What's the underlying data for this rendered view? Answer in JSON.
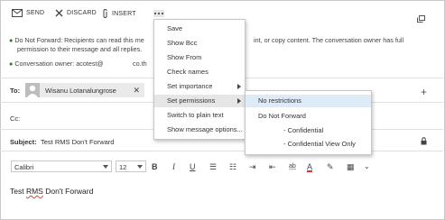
{
  "toolbar": {
    "send_label": "SEND",
    "discard_label": "DISCARD",
    "insert_label": "INSERT"
  },
  "info": {
    "dnf_text_1": "Do Not Forward: Recipients can read this me",
    "dnf_text_2": "int, or copy content. The conversation owner has full",
    "dnf_text_3": "permission to their message and all replies.",
    "owner_label": "Conversation owner: acotest@",
    "owner_domain": "co.th"
  },
  "to": {
    "label": "To:",
    "recipient": "Wisanu Lotanalungrose"
  },
  "cc": {
    "label": "Cc:"
  },
  "subject": {
    "label": "Subject:",
    "value": "Test RMS Don't Forward"
  },
  "format": {
    "font": "Calibri",
    "size": "12"
  },
  "body": {
    "text_prefix": "Test ",
    "text_rms": "RMS",
    "text_suffix": " Don't Forward"
  },
  "menu": {
    "items": [
      "Save",
      "Show Bcc",
      "Show From",
      "Check names",
      "Set importance",
      "Set permissions",
      "Switch to plain text",
      "Show message options..."
    ]
  },
  "submenu": {
    "items": [
      "No restrictions",
      "Do Not Forward",
      "- Confidential",
      "- Confidential View Only"
    ]
  },
  "colors": {
    "accent_green": "#2c7a33",
    "highlight": "#dfeaf7",
    "font_color_red": "#e03030"
  }
}
